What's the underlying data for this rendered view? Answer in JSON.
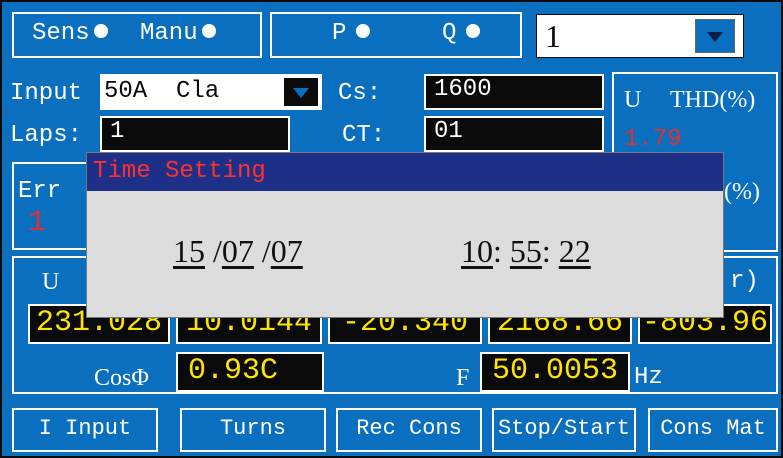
{
  "top": {
    "sens_label": "Sens",
    "manu_label": "Manu",
    "p_label": "P",
    "q_label": "Q",
    "selector_value": "1"
  },
  "rows": {
    "input_label": "Input",
    "input_value": "50A  Cla",
    "cs_label": "Cs:",
    "cs_value": "1600",
    "laps_label": "Laps:",
    "laps_value": "1",
    "ct_label": "CT:",
    "ct_value": "01"
  },
  "right_panel": {
    "u_label": "U",
    "thd_label": "THD(%)",
    "thd_value": "1.79",
    "pct2_label": "(%)"
  },
  "err": {
    "label": "Err",
    "value": "1"
  },
  "measure": {
    "u_header": "U",
    "r_header": "r)",
    "values": [
      "231.028",
      "10.0144",
      "-20.340",
      "2168.66",
      "-803.96"
    ],
    "cos_label": "CosΦ",
    "cos_value": "0.93C",
    "f_label": "F",
    "f_value": "50.0053",
    "hz_label": "Hz"
  },
  "buttons": [
    "I Input",
    "Turns",
    "Rec Cons",
    "Stop/Start",
    "Cons Mat"
  ],
  "dialog": {
    "title": "Time Setting",
    "day": "15",
    "month": "07",
    "year": "07",
    "hour": "10",
    "minute": "55",
    "second": "22",
    "date_sep": "/",
    "time_sep": ":"
  },
  "colors": {
    "background": "#0b6fc0",
    "accent_yellow": "#ffe400",
    "title_red": "#ff3030",
    "title_bar": "#1e2f88"
  }
}
